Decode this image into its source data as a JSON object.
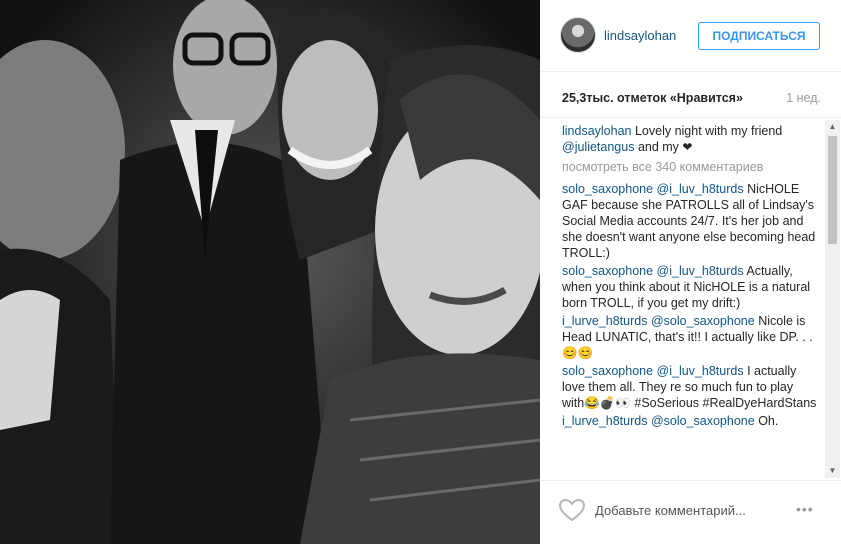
{
  "photo": {
    "alt_icon": "photo-image"
  },
  "header": {
    "username": "lindsaylohan",
    "follow_label": "ПОДПИСАТЬСЯ"
  },
  "stats": {
    "likes": "25,3тыс. отметок «Нравится»",
    "age": "1 нед."
  },
  "caption": {
    "user": "lindsaylohan",
    "text_before": " Lovely night with my friend ",
    "mention": "@julietangus",
    "text_after": " and my ",
    "emoji": "❤"
  },
  "view_all": "посмотреть все 340 комментариев",
  "comments": [
    {
      "user": "solo_saxophone",
      "mention": "@i_luv_h8turds",
      "text": "NicHOLE GAF because she PATROLLS all of Lindsay's Social Media accounts 24/7. It's her job and she doesn't want anyone else becoming head TROLL:)"
    },
    {
      "user": "solo_saxophone",
      "mention": "@i_luv_h8turds",
      "text": "Actually, when you think about it NicHOLE is a natural born TROLL, if you get my drift:)"
    },
    {
      "user": "i_lurve_h8turds",
      "mention": "@solo_saxophone",
      "text": "Nicole is Head LUNATIC, that's it!! I actually like DP. . .😊😊"
    },
    {
      "user": "solo_saxophone",
      "mention": "@i_luv_h8turds",
      "text": "I actually love them all. They re so much fun to play with😂💣👀 #SoSerious #RealDyeHardStans"
    },
    {
      "user": "i_lurve_h8turds",
      "mention": "@solo_saxophone",
      "text": "Oh."
    }
  ],
  "footer": {
    "add_comment_placeholder": "Добавьте комментарий...",
    "more": "•••"
  }
}
